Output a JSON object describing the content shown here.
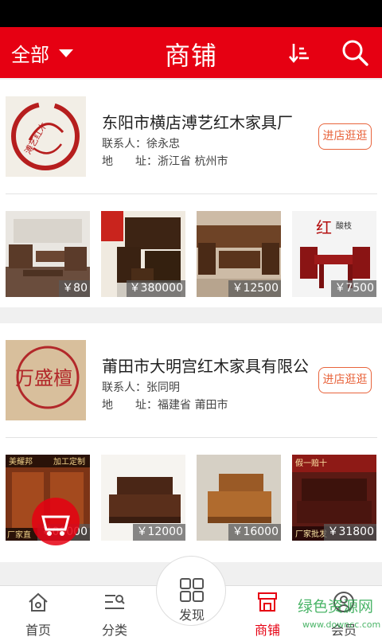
{
  "header": {
    "filter_label": "全部",
    "title": "商铺",
    "sort_icon": "sort-icon",
    "search_icon": "search-icon",
    "background": "#e60012"
  },
  "stores": [
    {
      "name": "东阳市横店溥艺红木家具厂",
      "contact": "联系人：徐永忠",
      "address_label": "地　　址：",
      "address": "浙江省 杭州市",
      "enter_label": "进店逛逛",
      "logo_text": "溥艺红木",
      "products": [
        {
          "price": "￥80"
        },
        {
          "price": "￥380000"
        },
        {
          "price": "￥12500"
        },
        {
          "price": "￥7500"
        }
      ]
    },
    {
      "name": "莆田市大明宫红木家具有限公...",
      "contact": "联系人：张同明",
      "address_label": "地　　址：",
      "address": "福建省 莆田市",
      "enter_label": "进店逛逛",
      "logo_text": "万盛檀",
      "products": [
        {
          "price": "￥00000",
          "overlay_top": "美耀邦",
          "overlay_top2": "加工定制",
          "overlay_bottom": "厂家直"
        },
        {
          "price": "￥12000"
        },
        {
          "price": "￥16000"
        },
        {
          "price": "￥31800",
          "overlay_top": "假一赔十",
          "overlay_bottom": "厂家批发"
        }
      ]
    }
  ],
  "bottom_nav": [
    {
      "label": "首页",
      "icon": "home-icon"
    },
    {
      "label": "分类",
      "icon": "category-icon"
    },
    {
      "label": "发现",
      "icon": "discover-icon"
    },
    {
      "label": "商铺",
      "icon": "shop-icon",
      "active": true
    },
    {
      "label": "会员",
      "icon": "member-icon"
    }
  ],
  "watermark": {
    "text1": "绿色资源网",
    "text2": "www.downcc.com"
  },
  "colors": {
    "accent": "#e60012",
    "button": "#e8643c",
    "green": "#2da94f"
  }
}
